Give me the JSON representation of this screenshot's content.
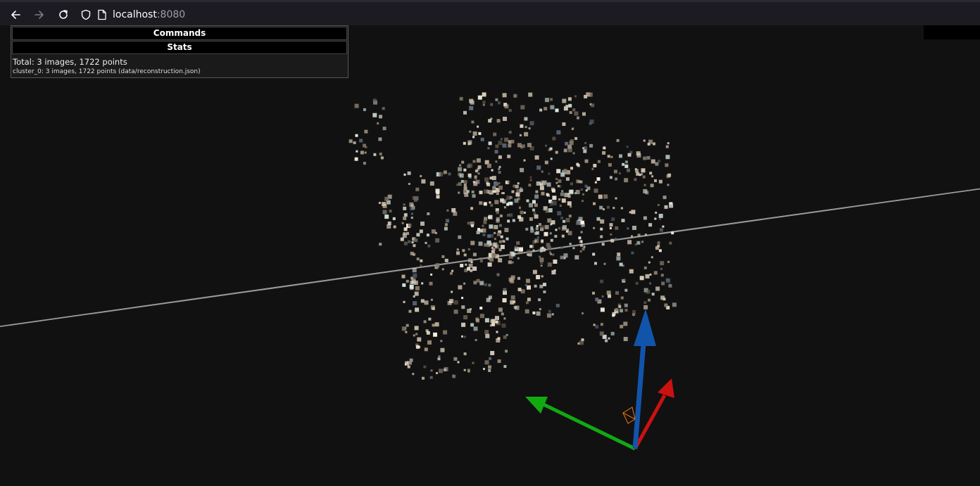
{
  "browser": {
    "url_host": "localhost",
    "url_port": ":8080"
  },
  "gui": {
    "commands_title": "Commands",
    "stats_title": "Stats",
    "stats_total": "Total: 3 images, 1722 points",
    "stats_cluster": "cluster_0: 3 images, 1722 points (data/reconstruction.json)"
  },
  "scene": {
    "background": "#111111",
    "grid_color": "#9a9a9a",
    "axis_colors": {
      "x": "#cc1111",
      "y": "#11aa11",
      "z": "#1155aa"
    },
    "camera_color": "#ff7700"
  }
}
